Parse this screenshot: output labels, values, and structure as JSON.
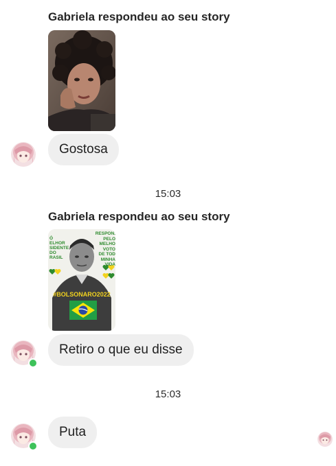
{
  "conversation": {
    "messages": [
      {
        "reply_label": "Gabriela respondeu ao seu story",
        "bubble_text": "Gostosa"
      },
      {
        "timestamp": "15:03",
        "reply_label": "Gabriela respondeu ao seu story",
        "story_text": {
          "left_lines": [
            "Ó",
            "ELHOR",
            "SIDENTE",
            "DO",
            "RASIL"
          ],
          "right_lines": [
            "RESPON.",
            "PELO",
            "MELHO",
            "VOTO",
            "DE TOD",
            "MINHA",
            "VIDA"
          ],
          "hashtag": "#BOLSONARO2022"
        },
        "bubble_text": "Retiro o que eu disse"
      },
      {
        "timestamp": "15:03",
        "bubble_text": "Puta"
      }
    ]
  },
  "colors": {
    "bubble_bg": "#efefef",
    "online_dot": "#3ec25a",
    "story_green": "#2e8b2e",
    "story_yellow": "#f2d21f"
  },
  "icons": [
    "contact-avatar",
    "online-status-dot",
    "seen-receipt-avatar",
    "brazil-flag"
  ]
}
